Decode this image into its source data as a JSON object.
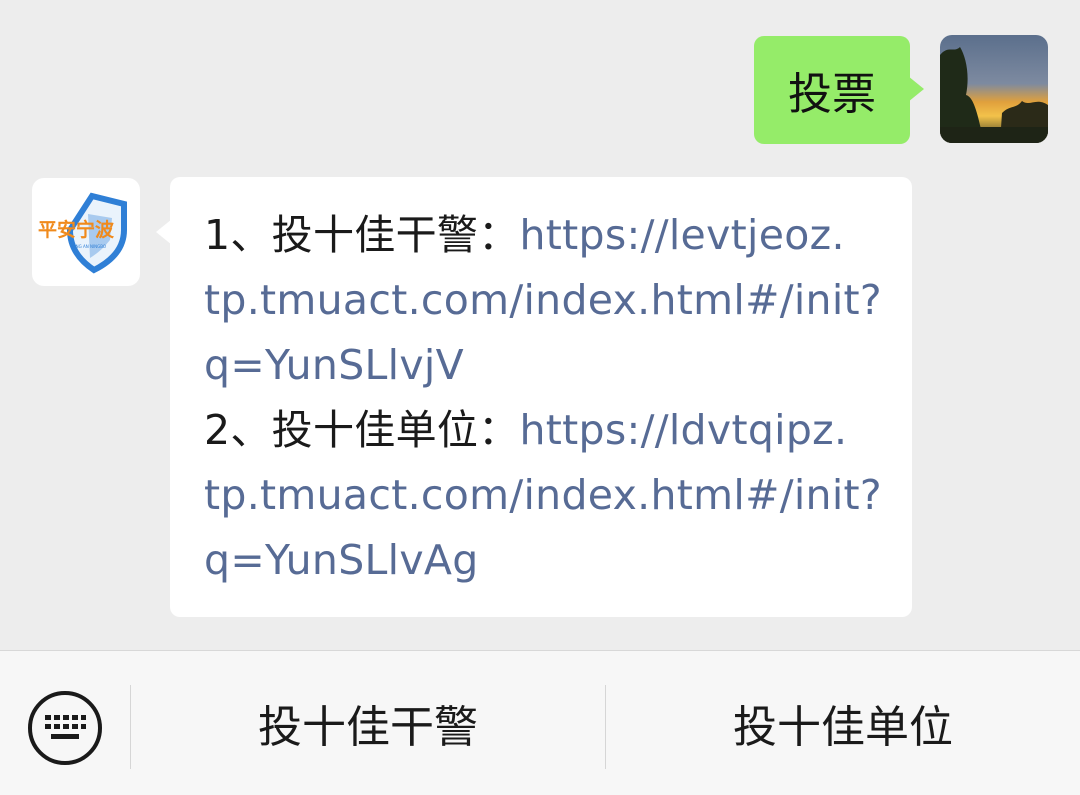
{
  "outgoing": {
    "text": "投票"
  },
  "incoming": {
    "lines": [
      {
        "label": "1、投十佳干警：",
        "link": "https://levtjeoz."
      },
      {
        "label": "",
        "link": "tp.tmuact.com/index.html#/init?"
      },
      {
        "label": "",
        "link": "q=YunSLlvjV"
      },
      {
        "label": "2、投十佳单位：",
        "link": "https://ldvtqipz."
      },
      {
        "label": "",
        "link": "tp.tmuact.com/index.html#/init?"
      },
      {
        "label": "",
        "link": "q=YunSLlvAg"
      }
    ]
  },
  "bot_avatar": {
    "logo_text": "平安宁波",
    "sub_text": "PING AN NINGBO"
  },
  "bottom_menu": {
    "items": [
      {
        "label": "投十佳干警"
      },
      {
        "label": "投十佳单位"
      }
    ]
  },
  "colors": {
    "background": "#ededed",
    "outgoing_bubble": "#95ec69",
    "link": "#576b95",
    "logo_orange": "#f08a1c",
    "logo_blue": "#2f7fd6"
  },
  "icons": {
    "keyboard": "keyboard-icon"
  }
}
